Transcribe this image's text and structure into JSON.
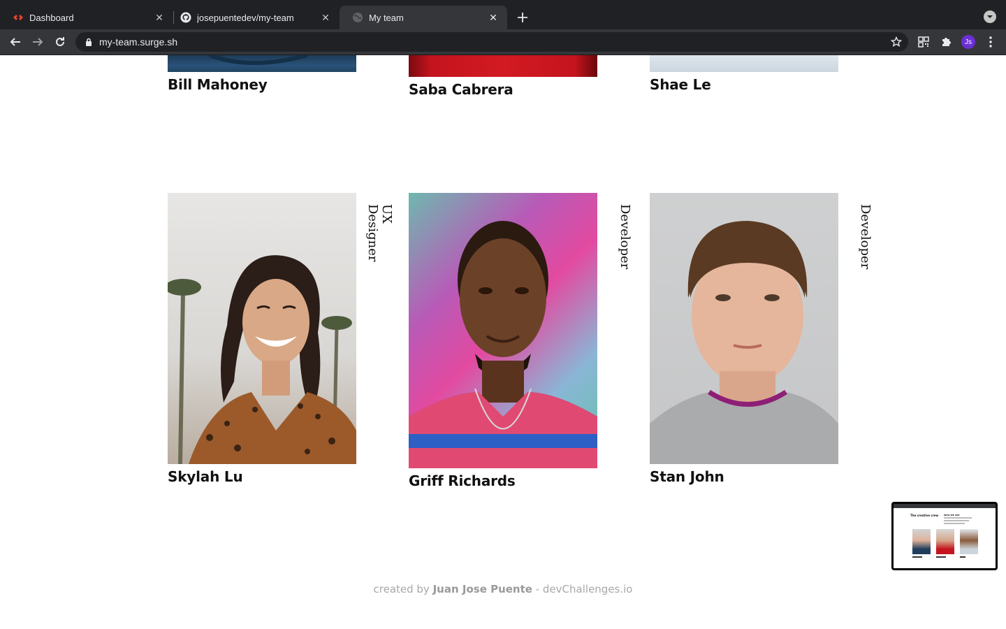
{
  "browser": {
    "tabs": [
      {
        "title": "Dashboard",
        "icon": "surge-icon",
        "active": false
      },
      {
        "title": "josepuentedev/my-team",
        "icon": "github-icon",
        "active": false
      },
      {
        "title": "My team",
        "icon": "globe-icon",
        "active": true
      }
    ],
    "url": "my-team.surge.sh",
    "profile_initials": "Js"
  },
  "team_top_row": [
    {
      "name": "Bill Mahoney"
    },
    {
      "name": "Saba Cabrera"
    },
    {
      "name": "Shae Le"
    }
  ],
  "team_bottom_row": [
    {
      "name": "Skylah Lu",
      "role": "UX Designer"
    },
    {
      "name": "Griff Richards",
      "role": "Developer"
    },
    {
      "name": "Stan John",
      "role": "Developer"
    }
  ],
  "footer": {
    "prefix": "created by",
    "author": "Juan Jose Puente",
    "suffix": "- devChallenges.io"
  },
  "pip": {
    "title": "The creative crew",
    "subtitle": "WHO WE ARE"
  },
  "colors": {
    "chrome_dark": "#202124",
    "chrome_tab": "#35363a",
    "avatar": "#6b2fd6",
    "footer_text": "#a8a8a8"
  }
}
